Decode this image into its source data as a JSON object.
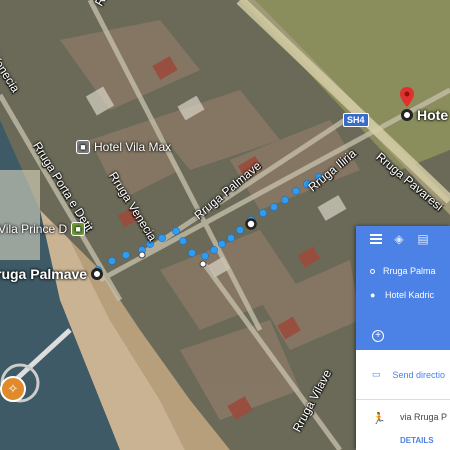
{
  "map": {
    "streets": [
      {
        "id": "venecia-top",
        "text": "Venecia"
      },
      {
        "id": "porta-detit",
        "text": "Rruga Porta e Detit"
      },
      {
        "id": "venecia",
        "text": "Rruga Venecia"
      },
      {
        "id": "palmave",
        "text": "Rruga Palmave"
      },
      {
        "id": "iliria",
        "text": "Rruga Iliria"
      },
      {
        "id": "pavaresise",
        "text": "Rruga Pavaresi"
      },
      {
        "id": "vilave",
        "text": "Rruga Vilave"
      },
      {
        "id": "top-cut",
        "text": "R"
      }
    ],
    "places": {
      "hotel_vila_max": "Hotel Vila Max",
      "vila_prince": "Vila Prince D"
    },
    "origin_label": "ruga Palmave",
    "destination_label": "Hote",
    "highway_shield": "SH4",
    "route_color": "#2f9cf0",
    "destination_pin_color": "#e2302e"
  },
  "panel": {
    "accent": "#4c82e6",
    "modes": [
      "menu-icon",
      "car-icon",
      "transit-icon"
    ],
    "origin": "Rruga Palma",
    "destination": "Hotel Kadric",
    "add_symbol": "+",
    "send_label": "Send directio",
    "route_via": "via Rruga P",
    "details_label": "DETAILS"
  }
}
